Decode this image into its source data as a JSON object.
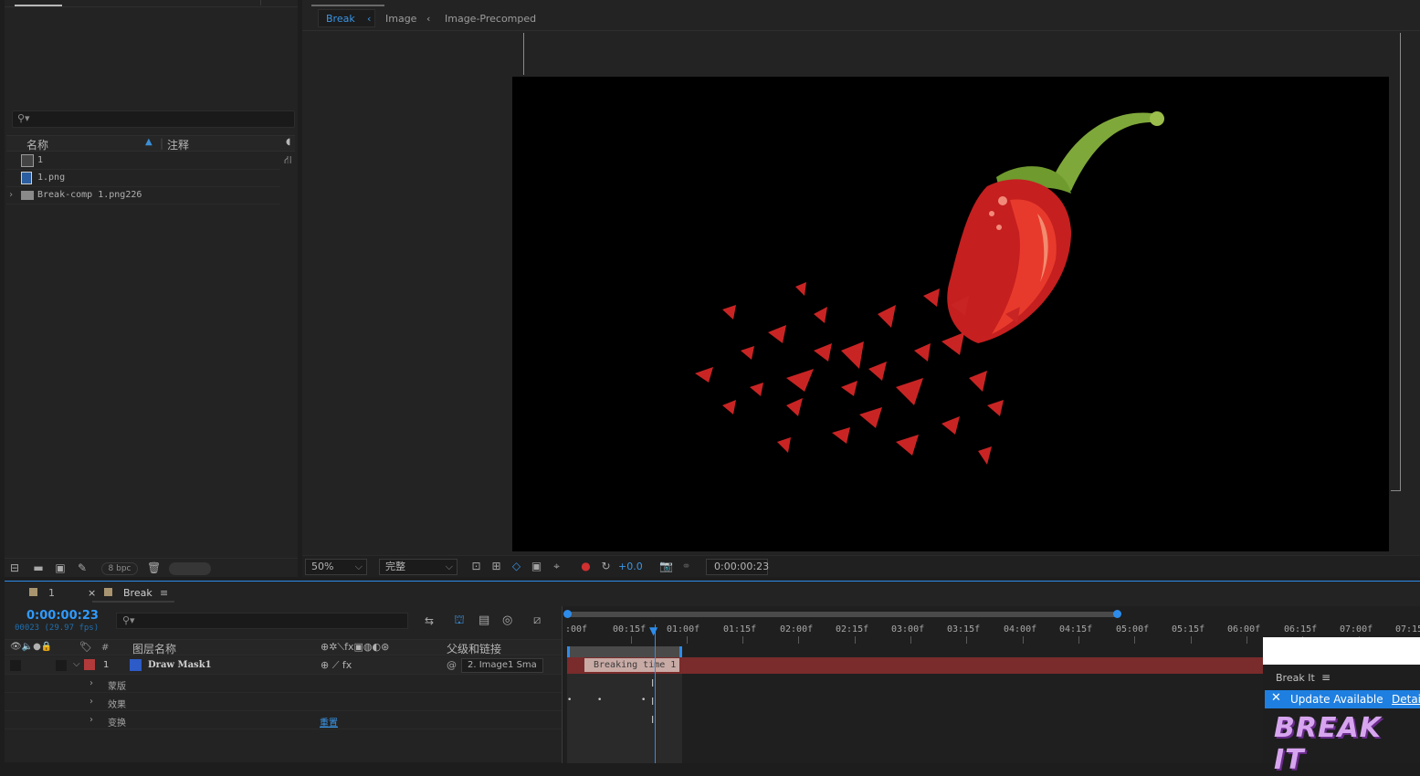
{
  "project": {
    "search_placeholder": "",
    "col_name": "名称",
    "col_comment": "注释",
    "items": [
      {
        "name": "1",
        "type": "composition"
      },
      {
        "name": "1.png",
        "type": "image"
      },
      {
        "name": "Break-comp 1.png226",
        "type": "folder"
      }
    ],
    "bpc": "8 bpc"
  },
  "viewer": {
    "breadcrumbs": [
      "Break",
      "Image",
      "Image-Precomped"
    ],
    "zoom": "50%",
    "resolution": "完整",
    "exposure": "+0.0",
    "timecode": "0:00:00:23"
  },
  "timeline": {
    "tabs": [
      "1",
      "Break"
    ],
    "current_time": "0:00:00:23",
    "frame_fps": "00023 (29.97 fps)",
    "col_num": "#",
    "col_layer_name": "图层名称",
    "col_parent": "父级和链接",
    "ruler": [
      ":00f",
      "00:15f",
      "01:00f",
      "01:15f",
      "02:00f",
      "02:15f",
      "03:00f",
      "03:15f",
      "04:00f",
      "04:15f",
      "05:00f",
      "05:15f",
      "06:00f",
      "06:15f",
      "07:00f",
      "07:15"
    ],
    "layers": [
      {
        "num": "1",
        "name": "Draw Mask1",
        "parent": "2. Image1 Sma"
      }
    ],
    "sub_props": [
      "蒙版",
      "效果",
      "变换"
    ],
    "reset_label": "重置",
    "marker_label": "Breaking time 1"
  },
  "breakit_panel": {
    "title": "Break It",
    "update_text": "Update Available",
    "details_text": "Detai",
    "logo_text": "BREAK IT"
  },
  "colors": {
    "accent": "#2d8ceb",
    "layer_label": "#b33a3a",
    "layer_bar": "#7a2b2b"
  }
}
